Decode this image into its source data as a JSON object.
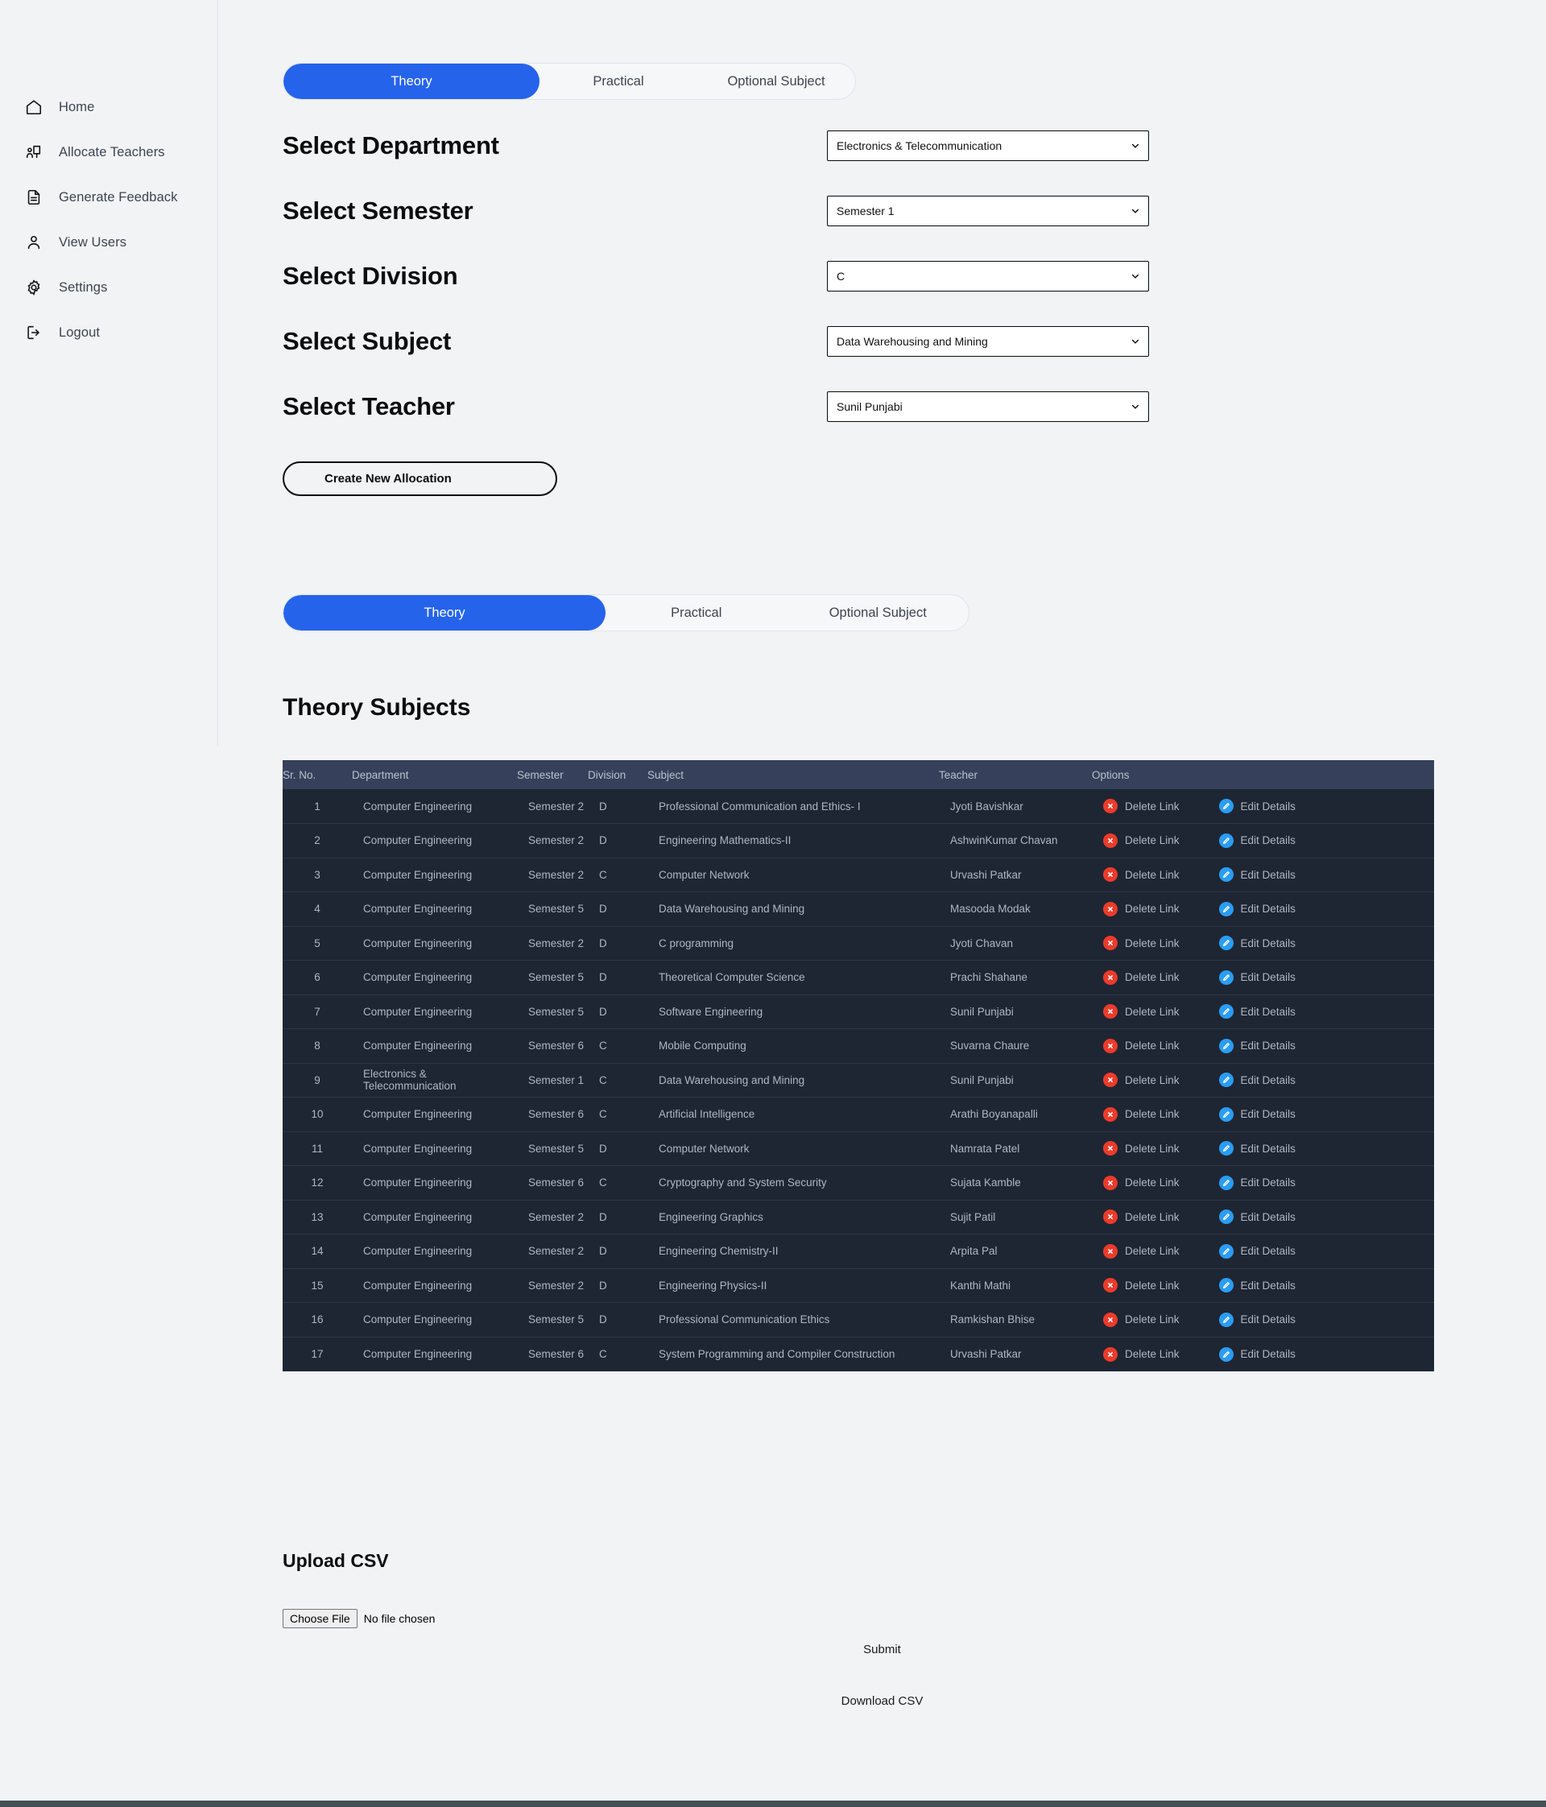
{
  "sidebar": {
    "items": [
      {
        "label": "Home",
        "icon": "home-icon"
      },
      {
        "label": "Allocate Teachers",
        "icon": "presentation-user-icon"
      },
      {
        "label": "Generate Feedback",
        "icon": "document-lines-icon"
      },
      {
        "label": "View Users",
        "icon": "user-icon"
      },
      {
        "label": "Settings",
        "icon": "gear-icon"
      },
      {
        "label": "Logout",
        "icon": "logout-icon"
      }
    ]
  },
  "top_tabs": {
    "items": [
      {
        "label": "Theory",
        "active": true
      },
      {
        "label": "Practical",
        "active": false
      },
      {
        "label": "Optional Subject",
        "active": false
      }
    ]
  },
  "form": {
    "rows": [
      {
        "label": "Select Department",
        "value": "Electronics & Telecommunication"
      },
      {
        "label": "Select Semester",
        "value": "Semester 1"
      },
      {
        "label": "Select Division",
        "value": "C"
      },
      {
        "label": "Select Subject",
        "value": "Data Warehousing and Mining"
      },
      {
        "label": "Select Teacher",
        "value": "Sunil Punjabi"
      }
    ],
    "create_button": "Create New Allocation"
  },
  "lower_tabs": {
    "items": [
      {
        "label": "Theory",
        "active": true
      },
      {
        "label": "Practical",
        "active": false
      },
      {
        "label": "Optional Subject",
        "active": false
      }
    ]
  },
  "section": {
    "title": "Theory Subjects"
  },
  "table": {
    "headers": [
      "Sr. No.",
      "Department",
      "Semester",
      "Division",
      "Subject",
      "Teacher",
      "Options"
    ],
    "action_delete": "Delete Link",
    "action_edit": "Edit Details",
    "rows": [
      {
        "sr": "1",
        "department": "Computer Engineering",
        "semester": "Semester 2",
        "division": "D",
        "subject": "Professional Communication and Ethics- I",
        "teacher": "Jyoti Bavishkar"
      },
      {
        "sr": "2",
        "department": "Computer Engineering",
        "semester": "Semester 2",
        "division": "D",
        "subject": "Engineering Mathematics-II",
        "teacher": "AshwinKumar Chavan"
      },
      {
        "sr": "3",
        "department": "Computer Engineering",
        "semester": "Semester 2",
        "division": "C",
        "subject": "Computer Network",
        "teacher": "Urvashi Patkar"
      },
      {
        "sr": "4",
        "department": "Computer Engineering",
        "semester": "Semester 5",
        "division": "D",
        "subject": "Data Warehousing and Mining",
        "teacher": "Masooda Modak"
      },
      {
        "sr": "5",
        "department": "Computer Engineering",
        "semester": "Semester 2",
        "division": "D",
        "subject": "C programming",
        "teacher": "Jyoti Chavan"
      },
      {
        "sr": "6",
        "department": "Computer Engineering",
        "semester": "Semester 5",
        "division": "D",
        "subject": "Theoretical Computer Science",
        "teacher": "Prachi Shahane"
      },
      {
        "sr": "7",
        "department": "Computer Engineering",
        "semester": "Semester 5",
        "division": "D",
        "subject": "Software Engineering",
        "teacher": "Sunil Punjabi"
      },
      {
        "sr": "8",
        "department": "Computer Engineering",
        "semester": "Semester 6",
        "division": "C",
        "subject": "Mobile Computing",
        "teacher": "Suvarna Chaure"
      },
      {
        "sr": "9",
        "department": "Electronics & Telecommunication",
        "semester": "Semester 1",
        "division": "C",
        "subject": "Data Warehousing and Mining",
        "teacher": "Sunil Punjabi"
      },
      {
        "sr": "10",
        "department": "Computer Engineering",
        "semester": "Semester 6",
        "division": "C",
        "subject": "Artificial Intelligence",
        "teacher": "Arathi Boyanapalli"
      },
      {
        "sr": "11",
        "department": "Computer Engineering",
        "semester": "Semester 5",
        "division": "D",
        "subject": "Computer Network",
        "teacher": "Namrata Patel"
      },
      {
        "sr": "12",
        "department": "Computer Engineering",
        "semester": "Semester 6",
        "division": "C",
        "subject": "Cryptography and System Security",
        "teacher": "Sujata Kamble"
      },
      {
        "sr": "13",
        "department": "Computer Engineering",
        "semester": "Semester 2",
        "division": "D",
        "subject": "Engineering Graphics",
        "teacher": "Sujit Patil"
      },
      {
        "sr": "14",
        "department": "Computer Engineering",
        "semester": "Semester 2",
        "division": "D",
        "subject": "Engineering Chemistry-II",
        "teacher": "Arpita Pal"
      },
      {
        "sr": "15",
        "department": "Computer Engineering",
        "semester": "Semester 2",
        "division": "D",
        "subject": "Engineering Physics-II",
        "teacher": "Kanthi Mathi"
      },
      {
        "sr": "16",
        "department": "Computer Engineering",
        "semester": "Semester 5",
        "division": "D",
        "subject": "Professional Communication Ethics",
        "teacher": "Ramkishan Bhise"
      },
      {
        "sr": "17",
        "department": "Computer Engineering",
        "semester": "Semester 6",
        "division": "C",
        "subject": "System Programming and Compiler Construction",
        "teacher": "Urvashi Patkar"
      }
    ]
  },
  "upload": {
    "title": "Upload CSV",
    "choose_file_label": "Choose File",
    "no_file_text": "No file chosen",
    "submit_label": "Submit",
    "download_label": "Download CSV"
  },
  "colors": {
    "accent_blue": "#2563eb",
    "table_header": "#36405a",
    "table_row": "#1e2633",
    "delete_red": "#ec3b2b",
    "edit_blue": "#2a9df4",
    "footer": "#445055"
  }
}
